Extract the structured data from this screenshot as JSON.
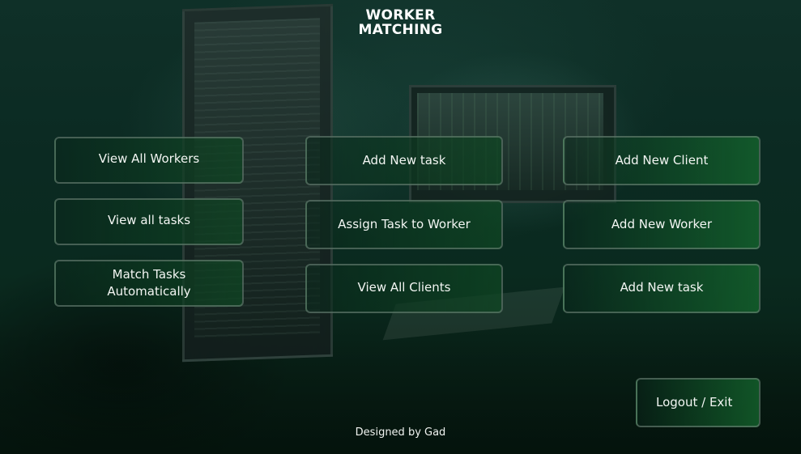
{
  "header": {
    "title_line1": "WORKER",
    "title_line2": "MATCHING"
  },
  "menu": {
    "view_all_workers": "View All Workers",
    "view_all_tasks": "View all tasks",
    "match_tasks_line1": "Match Tasks",
    "match_tasks_line2": "Automatically",
    "add_new_task_center": "Add New task",
    "assign_task_to_worker": "Assign Task to Worker",
    "view_all_clients": "View All Clients",
    "add_new_client": "Add New Client",
    "add_new_worker": "Add New Worker",
    "add_new_task_right": "Add New task",
    "logout_exit": "Logout / Exit"
  },
  "footer": {
    "credit": "Designed by Gad"
  },
  "colors": {
    "background": "#0b2a22",
    "button_border": "#788c82",
    "button_accent": "#14642d",
    "text": "#ffffff"
  }
}
